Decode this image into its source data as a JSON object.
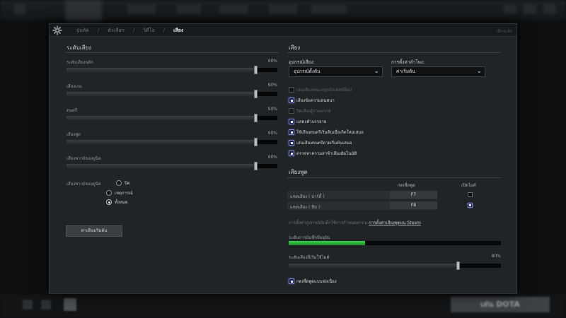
{
  "window": {
    "close_label": "เลิกระงับ"
  },
  "nav": {
    "tabs": [
      {
        "label": "ปุ่มลัด"
      },
      {
        "label": "ตัวเลือก"
      },
      {
        "label": "วิดีโอ"
      },
      {
        "label": "เสียง"
      }
    ],
    "active_tab": "เสียง",
    "separator": "/"
  },
  "levels": {
    "title": "ระดับเสียง",
    "sliders": [
      {
        "label": "ระดับเสียงหลัก",
        "value_text": "90%",
        "value": 0.9
      },
      {
        "label": "เสียงเกม",
        "value_text": "90%",
        "value": 0.9
      },
      {
        "label": "ดนตรี",
        "value_text": "90%",
        "value": 0.9
      },
      {
        "label": "เสียงพูด",
        "value_text": "90%",
        "value": 0.9
      },
      {
        "label": "เสียงพากย์ของยูนิต",
        "value_text": "90%",
        "value": 0.9
      }
    ],
    "unit_voice": {
      "label": "เสียงพากย์ของยูนิต",
      "options": [
        {
          "label": "ปิด",
          "selected": false
        },
        {
          "label": "เหตุการณ์",
          "selected": false
        },
        {
          "label": "ทั้งหมด",
          "selected": true
        }
      ]
    },
    "reset_button": "ค่าเสียงเริ่มต้น"
  },
  "sound": {
    "title": "เสียง",
    "device_label": "อุปกรณ์เสียง:",
    "device_value": "อุปกรณ์ตั้งต้น",
    "speaker_label": "การตั้งค่าลำโพง:",
    "speaker_value": "ค่าเริ่มต้น",
    "options": [
      {
        "label": "เล่นเสียงขณะอยู่หน้าเดสก์ท็อป",
        "checked": false
      },
      {
        "label": "เสียงข้อความสนทนา",
        "checked": true
      },
      {
        "label": "ปิดเสียงผู้ร่วมพากย์",
        "checked": false
      },
      {
        "label": "แสดงคำบรรยาย",
        "checked": true
      },
      {
        "label": "ใช้เสียงดนตรีเริ่มต้นเมื่อเกิดใหม่เสมอ",
        "checked": true
      },
      {
        "label": "เล่นเสียงดนตรีตายเริ่มต้นเสมอ",
        "checked": true
      },
      {
        "label": "ตรวจหาความล่าช้าเสียงอัตโนมัติ",
        "checked": true
      }
    ]
  },
  "voice": {
    "title": "เสียงพูด",
    "col_push": "กดเพื่อพูด",
    "col_mic": "เปิดไมค์",
    "rows": [
      {
        "name": "แชทเสียง ( ปาร์ตี้ )",
        "key": "F7",
        "mic_on": false
      },
      {
        "name": "แชทเสียง ( ทีม )",
        "key": "F8",
        "mic_on": true
      }
    ],
    "note_prefix": "การตั้งค่าอุปกรณ์บันทึกใช้การกำหนดค่าบน",
    "note_link": "การตั้งค่าเสียงพูดบน Steam",
    "record_label": "ระดับการบันทึกปัจจุบัน",
    "record_level": 0.36,
    "threshold_label": "ระดับเสียงที่เริ่มใช้ไมค์",
    "threshold_value_text": "80%",
    "threshold_value": 0.8,
    "continuous": {
      "label": "กดเพื่อพูดแบบต่อเนื่อง",
      "checked": true
    }
  },
  "colors": {
    "accent_check": "#7b86c9",
    "meter_green": "#3fd04f"
  },
  "background": {
    "play_button": "เล่น DOTA"
  }
}
